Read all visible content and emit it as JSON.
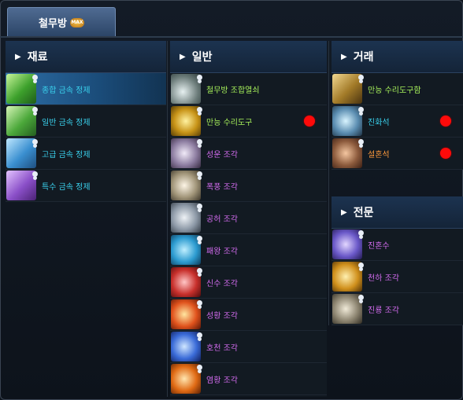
{
  "tab": {
    "label": "철무방",
    "badge_text": "MAX"
  },
  "columns": {
    "materials": {
      "header": "재료",
      "items": [
        {
          "label": "종합 금속 정제",
          "color": "#39d0ec",
          "icon": "ingot-green-icon",
          "selected": true
        },
        {
          "label": "일반 금속 정제",
          "color": "#39d0ec",
          "icon": "ingot-g-icon"
        },
        {
          "label": "고급 금속 정제",
          "color": "#39d0ec",
          "icon": "ingot-blue-icon"
        },
        {
          "label": "특수 금속 정제",
          "color": "#39d0ec",
          "icon": "ingot-purple-icon"
        }
      ]
    },
    "general": {
      "header": "일반",
      "items": [
        {
          "label": "철무방 조합열쇠",
          "color": "#a6f05a",
          "icon": "key-icon"
        },
        {
          "label": "만능 수리도구",
          "color": "#a6f05a",
          "icon": "repair-tool-icon",
          "red_dot": true
        },
        {
          "label": "성운 조각",
          "color": "#d46cf0",
          "icon": "nebula-fragment-icon"
        },
        {
          "label": "폭풍 조각",
          "color": "#d46cf0",
          "icon": "storm-fragment-icon"
        },
        {
          "label": "공허 조각",
          "color": "#d46cf0",
          "icon": "void-fragment-icon"
        },
        {
          "label": "패왕 조각",
          "color": "#d46cf0",
          "icon": "overlord-fragment-icon"
        },
        {
          "label": "신수 조각",
          "color": "#d46cf0",
          "icon": "divine-beast-fragment-icon"
        },
        {
          "label": "성황 조각",
          "color": "#d46cf0",
          "icon": "sacred-fragment-icon"
        },
        {
          "label": "호천 조각",
          "color": "#d46cf0",
          "icon": "sky-fragment-icon"
        },
        {
          "label": "염황 조각",
          "color": "#d46cf0",
          "icon": "flame-fragment-icon"
        }
      ]
    },
    "trade": {
      "header": "거래",
      "items": [
        {
          "label": "만능 수리도구함",
          "color": "#a6f05a",
          "icon": "repair-chest-icon"
        },
        {
          "label": "진화석",
          "color": "#39d0ec",
          "icon": "evolution-stone-icon",
          "red_dot": true
        },
        {
          "label": "설혼석",
          "color": "#ff9a3c",
          "icon": "soul-stone-icon",
          "red_dot": true
        }
      ]
    },
    "expert": {
      "header": "전문",
      "items": [
        {
          "label": "진혼수",
          "color": "#d46cf0",
          "icon": "requiem-water-icon"
        },
        {
          "label": "천하 조각",
          "color": "#d46cf0",
          "icon": "realm-fragment-icon"
        },
        {
          "label": "진룡 조각",
          "color": "#d46cf0",
          "icon": "true-dragon-fragment-icon"
        }
      ]
    }
  }
}
